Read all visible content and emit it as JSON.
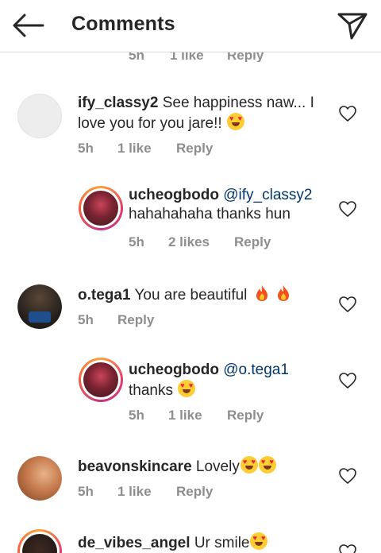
{
  "header": {
    "title": "Comments",
    "back_icon": "arrow-left-icon",
    "share_icon": "paper-plane-icon"
  },
  "clipped_previous_meta": {
    "time": "5h",
    "likes": "1 like",
    "reply": "Reply"
  },
  "comments": [
    {
      "username": "ify_classy2",
      "text": "See happiness naw... I love you for you jare!!",
      "emoji": "heart-eyes-emoji",
      "time": "5h",
      "likes": "1 like",
      "reply": "Reply"
    },
    {
      "username": "ucheogbodo",
      "mention": "@ify_classy2",
      "text": "hahahahaha thanks hun",
      "time": "5h",
      "likes": "2 likes",
      "reply": "Reply",
      "is_reply": true
    },
    {
      "username": "o.tega1",
      "text": "You are beautiful",
      "emoji": "fire-emoji",
      "time": "5h",
      "reply": "Reply"
    },
    {
      "username": "ucheogbodo",
      "mention": "@o.tega1",
      "text": "thanks",
      "emoji": "heart-eyes-emoji",
      "time": "5h",
      "likes": "1 like",
      "reply": "Reply",
      "is_reply": true
    },
    {
      "username": "beavonskincare",
      "text": "Lovely",
      "emoji": "heart-eyes-emoji",
      "time": "5h",
      "likes": "1 like",
      "reply": "Reply"
    },
    {
      "username": "de_vibes_angel",
      "text": "Ur smile",
      "emoji": "heart-eyes-emoji"
    }
  ],
  "colors": {
    "text": "#262626",
    "meta": "#8e8e8e",
    "mention": "#003569",
    "divider": "#dbdbdb"
  }
}
